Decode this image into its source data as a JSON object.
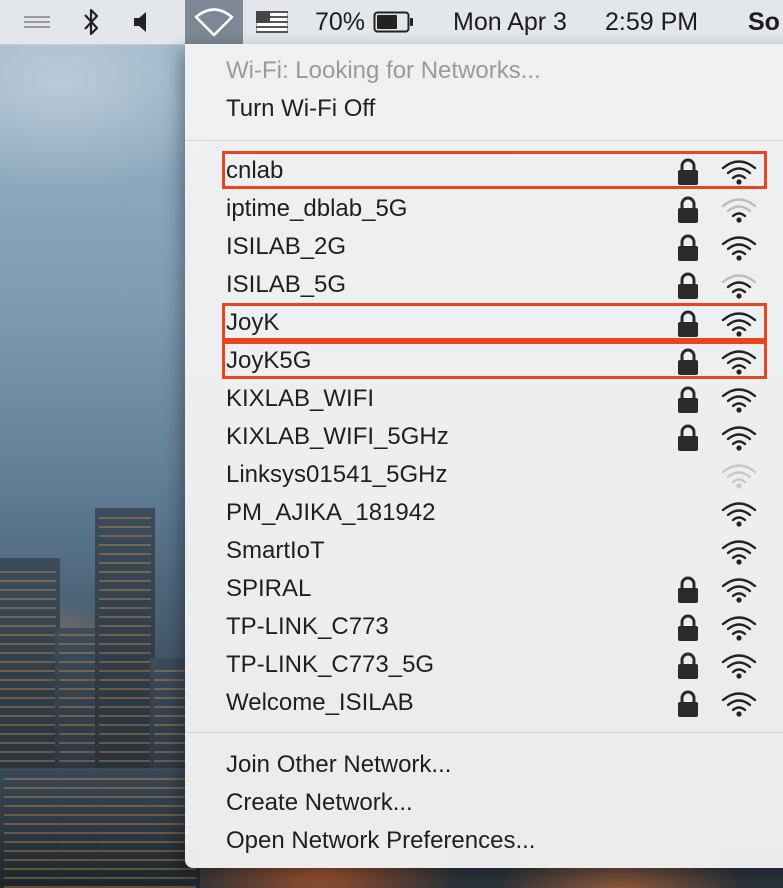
{
  "menubar": {
    "battery_percent": "70%",
    "battery_level": 0.7,
    "date": "Mon Apr 3",
    "time": "2:59 PM",
    "user_truncated": "So",
    "icons": [
      "sidebar-lines-icon",
      "bluetooth-icon",
      "volume-icon",
      "wifi-icon",
      "us-flag-icon",
      "battery-icon"
    ]
  },
  "wifi_menu": {
    "status": "Wi-Fi: Looking for Networks...",
    "toggle_label": "Turn Wi-Fi Off",
    "networks": [
      {
        "name": "cnlab",
        "locked": true,
        "signal": "strong",
        "highlighted": true
      },
      {
        "name": "iptime_dblab_5G",
        "locked": true,
        "signal": "weak",
        "highlighted": false
      },
      {
        "name": "ISILAB_2G",
        "locked": true,
        "signal": "strong",
        "highlighted": false
      },
      {
        "name": "ISILAB_5G",
        "locked": true,
        "signal": "medium",
        "highlighted": false
      },
      {
        "name": "JoyK",
        "locked": true,
        "signal": "strong",
        "highlighted": true
      },
      {
        "name": "JoyK5G",
        "locked": true,
        "signal": "strong",
        "highlighted": true
      },
      {
        "name": "KIXLAB_WIFI",
        "locked": true,
        "signal": "strong",
        "highlighted": false
      },
      {
        "name": "KIXLAB_WIFI_5GHz",
        "locked": true,
        "signal": "strong",
        "highlighted": false
      },
      {
        "name": "Linksys01541_5GHz",
        "locked": false,
        "signal": "faint",
        "highlighted": false
      },
      {
        "name": "PM_AJIKA_181942",
        "locked": false,
        "signal": "strong",
        "highlighted": false
      },
      {
        "name": "SmartIoT",
        "locked": false,
        "signal": "strong",
        "highlighted": false
      },
      {
        "name": "SPIRAL",
        "locked": true,
        "signal": "strong",
        "highlighted": false
      },
      {
        "name": "TP-LINK_C773",
        "locked": true,
        "signal": "strong",
        "highlighted": false
      },
      {
        "name": "TP-LINK_C773_5G",
        "locked": true,
        "signal": "strong",
        "highlighted": false
      },
      {
        "name": "Welcome_ISILAB",
        "locked": true,
        "signal": "strong",
        "highlighted": false
      }
    ],
    "actions": {
      "join_other": "Join Other Network...",
      "create": "Create Network...",
      "preferences": "Open Network Preferences..."
    }
  },
  "colors": {
    "highlight_border": "#e8461f",
    "menu_background": "#f2f2f3",
    "text_primary": "#1f1f1f",
    "text_disabled": "#9a9a9a"
  }
}
